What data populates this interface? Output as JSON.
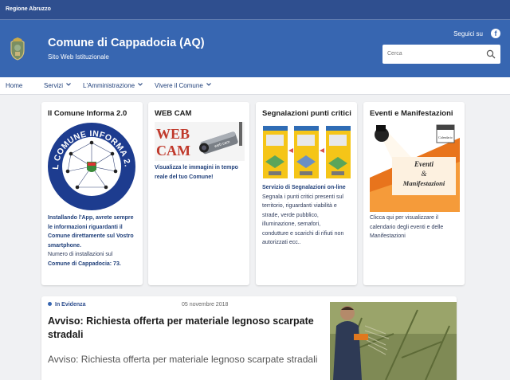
{
  "top_bar": {
    "region": "Regione Abruzzo"
  },
  "header": {
    "title": "Comune di Cappadocia (AQ)",
    "subtitle": "Sito Web Istituzionale",
    "follow_label": "Seguici su",
    "facebook_glyph": "f",
    "search_placeholder": "Cerca"
  },
  "nav": {
    "items": [
      "Home",
      "Servizi",
      "L'Amministrazione",
      "Vivere il Comune"
    ]
  },
  "cards": [
    {
      "title": "Il Comune Informa 2.0",
      "image_text": "IL COMUNE INFORMA 2.0",
      "lines": [
        {
          "text": "Installando l'App, avrete sempre",
          "bold": true
        },
        {
          "text": "le informazioni riguardanti il",
          "bold": true
        },
        {
          "text": "Comune direttamente sul Vostro",
          "bold": true
        },
        {
          "text": "smartphone.",
          "bold": true
        },
        {
          "text": "Numero di installazioni sul",
          "bold": false
        },
        {
          "text": "Comune di Cappadocia: 73.",
          "bold": true
        }
      ]
    },
    {
      "title": "WEB CAM",
      "image_text_1": "WEB",
      "image_text_2": "CAM",
      "image_cam_label": "web cam",
      "lines": [
        {
          "text": "Visualizza le immagini in tempo",
          "bold": true
        },
        {
          "text": "reale del tuo Comune!",
          "bold": true
        }
      ]
    },
    {
      "title": "Segnalazioni punti critici",
      "lines": [
        {
          "text": "Servizio di Segnalazioni on-line",
          "bold": true
        },
        {
          "text": "Segnala i punti critici presenti sul",
          "bold": false
        },
        {
          "text": "territorio, riguardanti viabilità e",
          "bold": false
        },
        {
          "text": "strade, verde pubblico,",
          "bold": false
        },
        {
          "text": "illuminazione, semafori,",
          "bold": false
        },
        {
          "text": "condutture e scarichi di rifiuti non",
          "bold": false
        },
        {
          "text": "autorizzati ecc..",
          "bold": false
        }
      ]
    },
    {
      "title": "Eventi e Manifestazioni",
      "image_text_1": "Eventi",
      "image_text_2": "&",
      "image_text_3": "Manifestazioni",
      "image_calendar_label": "Calendario",
      "lines": [
        {
          "text": "Clicca qui per visualizzare il",
          "bold": false
        },
        {
          "text": "calendario degli eventi e delle",
          "bold": false
        },
        {
          "text": "Manifestazioni",
          "bold": false
        }
      ]
    }
  ],
  "news": {
    "tag": "In Evidenza",
    "date": "05 novembre 2018",
    "title": "Avviso: Richiesta offerta per materiale legnoso scarpate stradali",
    "summary": "Avviso: Richiesta offerta per materiale legnoso scarpate stradali"
  },
  "colors": {
    "top_bar": "#2f4f8f",
    "header": "#3766b1",
    "nav_text": "#1f3f7a",
    "page_bg": "#f0f1f3"
  }
}
